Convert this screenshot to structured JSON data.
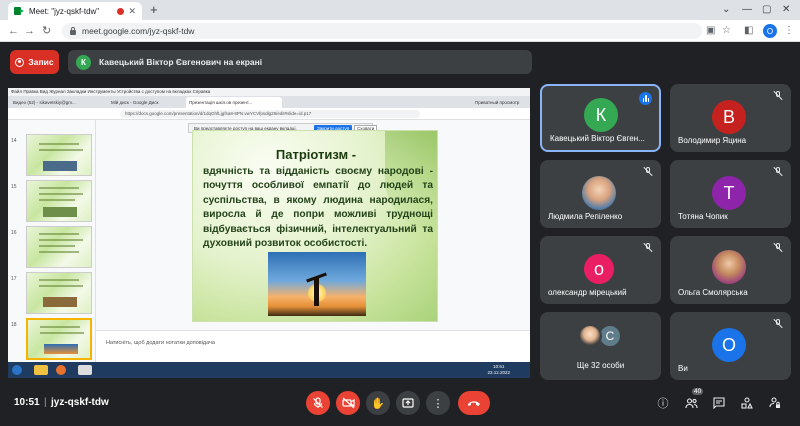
{
  "browser": {
    "tab_title": "Meet: \"jyz-qskf-tdw\"",
    "tab_close": "✕",
    "new_tab": "+",
    "url": "meet.google.com/jyz-qskf-tdw",
    "profile_initial": "O",
    "window_controls": [
      "—",
      "▢",
      "✕"
    ]
  },
  "header": {
    "record_label": "Запис",
    "presenter_initial": "К",
    "presenter_banner": "Кавецький Віктор Євгенович на екрані"
  },
  "shared_screen": {
    "menubar": "Файл  Правка  Вид  Журнал  Закладки  Инструменты  Устройства с доступом на вкладках  Справка",
    "tabs": [
      "Видео (52) - sikavetskiy@gm...",
      "Мій диск - Google Диск",
      "Презентація шкіл.ов презент...",
      "Приватный просмотр"
    ],
    "url": "https://docs.google.com/presentation/d/1dqGhfLjgfsa8-8PN.vwYCVfpsdlg28/edit#slide=id.p17",
    "share_notice": "Ви представляєте доступ на ваш екрану вкладці.",
    "share_stop": "Закрити доступ",
    "share_hide": "Сховати",
    "slide_numbers": [
      "14",
      "15",
      "16",
      "17",
      "18"
    ],
    "notes_placeholder": "Натисніть, щоб додати нотатки доповідача",
    "clock_time": "10:51",
    "clock_date": "23.12.2022",
    "slide": {
      "title": "Патріотизм -",
      "body": "вдячність та відданість своєму народові - почуття особливої емпатії до людей та суспільства, в якому людина народилася, виросла й де попри можливі труднощі відбувається фізичний, інтелектуальний та духовний розвиток особистості."
    }
  },
  "participants": [
    {
      "name": "Кавецький Віктор Євген...",
      "initial": "К",
      "color": "#34a853",
      "speaking": true
    },
    {
      "name": "Володимир Яцина",
      "initial": "В",
      "color": "#c5221f",
      "speaking": false
    },
    {
      "name": "Людмила Репіленко",
      "initial": "",
      "color": "#ffffff",
      "speaking": false
    },
    {
      "name": "Тотяна Чопик",
      "initial": "Т",
      "color": "#8e24aa",
      "speaking": false
    },
    {
      "name": "олександр мірецький",
      "initial": "о",
      "color": "#e91e63",
      "speaking": false
    },
    {
      "name": "Ольга Смолярська",
      "initial": "",
      "color": "#ffffff",
      "speaking": false
    },
    {
      "name": "Ще 32 особи",
      "initial": "С",
      "color": "#607d8b",
      "speaking": false
    },
    {
      "name": "Ви",
      "initial": "О",
      "color": "#1a73e8",
      "speaking": false
    }
  ],
  "bottom_bar": {
    "time": "10:51",
    "separator": "|",
    "meeting_code": "jyz-qskf-tdw",
    "participant_count": "40"
  },
  "colors": {
    "accent": "#8ab4f8",
    "danger": "#ea4335",
    "surface": "#3c4043",
    "background": "#202124"
  }
}
